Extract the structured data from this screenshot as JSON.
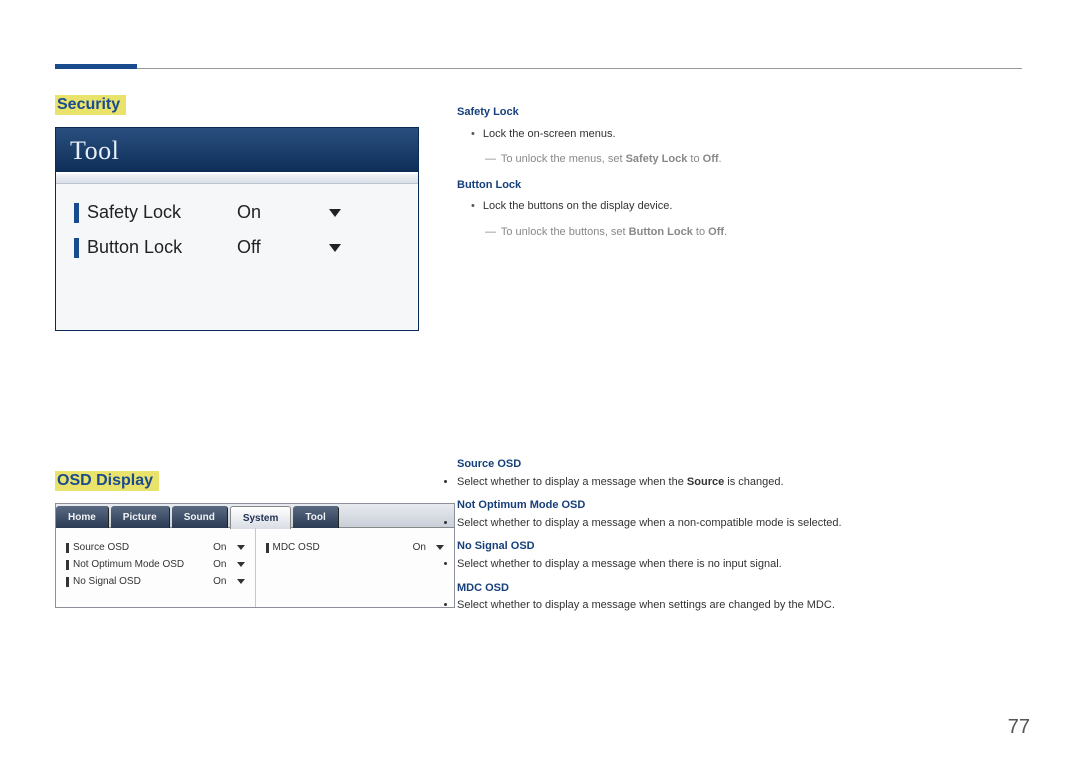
{
  "page_number": "77",
  "sections": {
    "security": {
      "heading": "Security",
      "screenshot": {
        "title": "Tool",
        "rows": [
          {
            "label": "Safety Lock",
            "value": "On"
          },
          {
            "label": "Button Lock",
            "value": "Off"
          }
        ]
      },
      "descriptions": {
        "safety_lock": {
          "title": "Safety Lock",
          "bullet": "Lock the on-screen menus.",
          "note_prefix": "To unlock the menus, set ",
          "note_bold1": "Safety Lock",
          "note_mid": " to ",
          "note_bold2": "Off",
          "note_suffix": "."
        },
        "button_lock": {
          "title": "Button Lock",
          "bullet": "Lock the buttons on the display device.",
          "note_prefix": "To unlock the buttons, set ",
          "note_bold1": "Button Lock",
          "note_mid": " to ",
          "note_bold2": "Off",
          "note_suffix": "."
        }
      }
    },
    "osd": {
      "heading": "OSD Display",
      "screenshot": {
        "tabs": [
          "Home",
          "Picture",
          "Sound",
          "System",
          "Tool"
        ],
        "active_tab_index": 3,
        "left_rows": [
          {
            "label": "Source OSD",
            "value": "On"
          },
          {
            "label": "Not Optimum Mode OSD",
            "value": "On"
          },
          {
            "label": "No Signal OSD",
            "value": "On"
          }
        ],
        "right_rows": [
          {
            "label": "MDC OSD",
            "value": "On"
          }
        ]
      },
      "descriptions": {
        "source_osd": {
          "title": "Source OSD",
          "bullet_prefix": "Select whether to display a message when the ",
          "bullet_bold": "Source",
          "bullet_suffix": " is changed."
        },
        "not_optimum": {
          "title": "Not Optimum Mode OSD",
          "bullet": "Select whether to display a message when a non-compatible mode is selected."
        },
        "no_signal": {
          "title": "No Signal OSD",
          "bullet": "Select whether to display a message when there is no input signal."
        },
        "mdc_osd": {
          "title": "MDC OSD",
          "bullet": "Select whether to display a message when settings are changed by the MDC."
        }
      }
    }
  }
}
